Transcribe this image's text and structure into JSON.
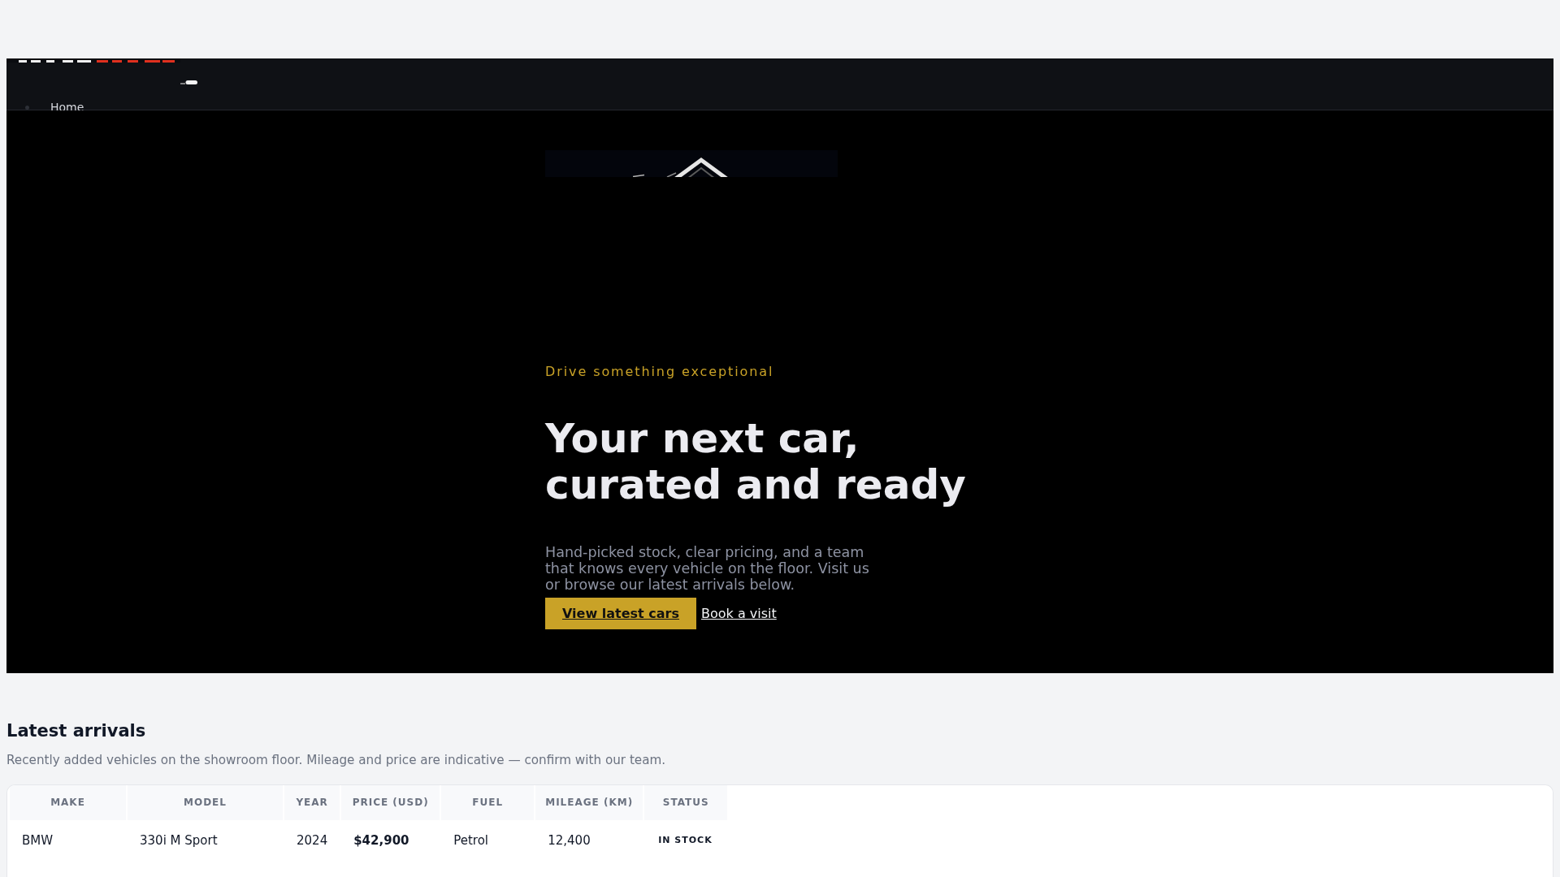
{
  "header": {
    "nav": [
      {
        "label": "Home"
      }
    ]
  },
  "hero": {
    "eyebrow": "Drive something exceptional",
    "title": "Your next car, curated and ready",
    "text": "Hand-picked stock, clear pricing, and a team that knows every vehicle on the floor. Visit us or browse our latest arrivals below.",
    "primary_button": "View latest cars",
    "secondary_link": "Book a visit"
  },
  "arrivals": {
    "title": "Latest arrivals",
    "subtitle": "Recently added vehicles on the showroom floor. Mileage and price are indicative — confirm with our team.",
    "table": {
      "columns": [
        "MAKE",
        "MODEL",
        "YEAR",
        "PRICE (USD)",
        "FUEL",
        "MILEAGE (KM)",
        "STATUS"
      ],
      "rows": [
        {
          "make": "BMW",
          "model": "330i M Sport",
          "year": "2024",
          "price": "$42,900",
          "fuel": "Petrol",
          "mileage": "12,400",
          "status": "IN STOCK"
        }
      ]
    }
  }
}
